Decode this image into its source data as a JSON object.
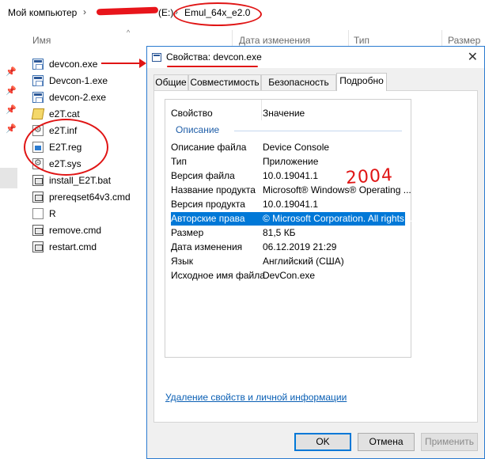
{
  "address": {
    "computer": "Мой компьютер",
    "sep1": "›",
    "hidden_part": "(E:)",
    "sep2": "›",
    "folder": "Emul_64x_e2.0"
  },
  "columns": {
    "name": "Имя",
    "date": "Дата изменения",
    "type": "Тип",
    "size": "Размер"
  },
  "files": [
    {
      "name": "devcon.exe",
      "icon": "exe-icon"
    },
    {
      "name": "Devcon-1.exe",
      "icon": "exe-icon"
    },
    {
      "name": "devcon-2.exe",
      "icon": "exe-icon"
    },
    {
      "name": "e2T.cat",
      "icon": "catalog-icon"
    },
    {
      "name": "e2T.inf",
      "icon": "inf-icon"
    },
    {
      "name": "E2T.reg",
      "icon": "reg-icon"
    },
    {
      "name": "e2T.sys",
      "icon": "sys-icon"
    },
    {
      "name": "install_E2T.bat",
      "icon": "batch-icon"
    },
    {
      "name": "prereqset64v3.cmd",
      "icon": "batch-icon"
    },
    {
      "name": "R",
      "icon": "file-icon"
    },
    {
      "name": "remove.cmd",
      "icon": "batch-icon"
    },
    {
      "name": "restart.cmd",
      "icon": "batch-icon"
    }
  ],
  "dialog": {
    "title": "Свойства: devcon.exe",
    "close": "✕",
    "tabs": [
      "Общие",
      "Совместимость",
      "Безопасность",
      "Подробно"
    ],
    "active_tab": "Подробно",
    "grid_header": {
      "property": "Свойство",
      "value": "Значение"
    },
    "section": "Описание",
    "rows": [
      {
        "k": "Описание файла",
        "v": "Device Console"
      },
      {
        "k": "Тип",
        "v": "Приложение"
      },
      {
        "k": "Версия файла",
        "v": "10.0.19041.1"
      },
      {
        "k": "Название продукта",
        "v": "Microsoft® Windows® Operating ..."
      },
      {
        "k": "Версия продукта",
        "v": "10.0.19041.1"
      },
      {
        "k": "Авторские права",
        "v": "© Microsoft Corporation. All rights ..."
      },
      {
        "k": "Размер",
        "v": "81,5 КБ"
      },
      {
        "k": "Дата изменения",
        "v": "06.12.2019 21:29"
      },
      {
        "k": "Язык",
        "v": "Английский (США)"
      },
      {
        "k": "Исходное имя файла",
        "v": "DevCon.exe"
      }
    ],
    "selected_row": "Авторские права",
    "annotation": "2004",
    "remove_link": "Удаление свойств и личной информации",
    "buttons": {
      "ok": "OK",
      "cancel": "Отмена",
      "apply": "Применить"
    }
  },
  "colors": {
    "accent": "#0078d7",
    "annotation": "#e01515",
    "link": "#0a5fb4"
  }
}
